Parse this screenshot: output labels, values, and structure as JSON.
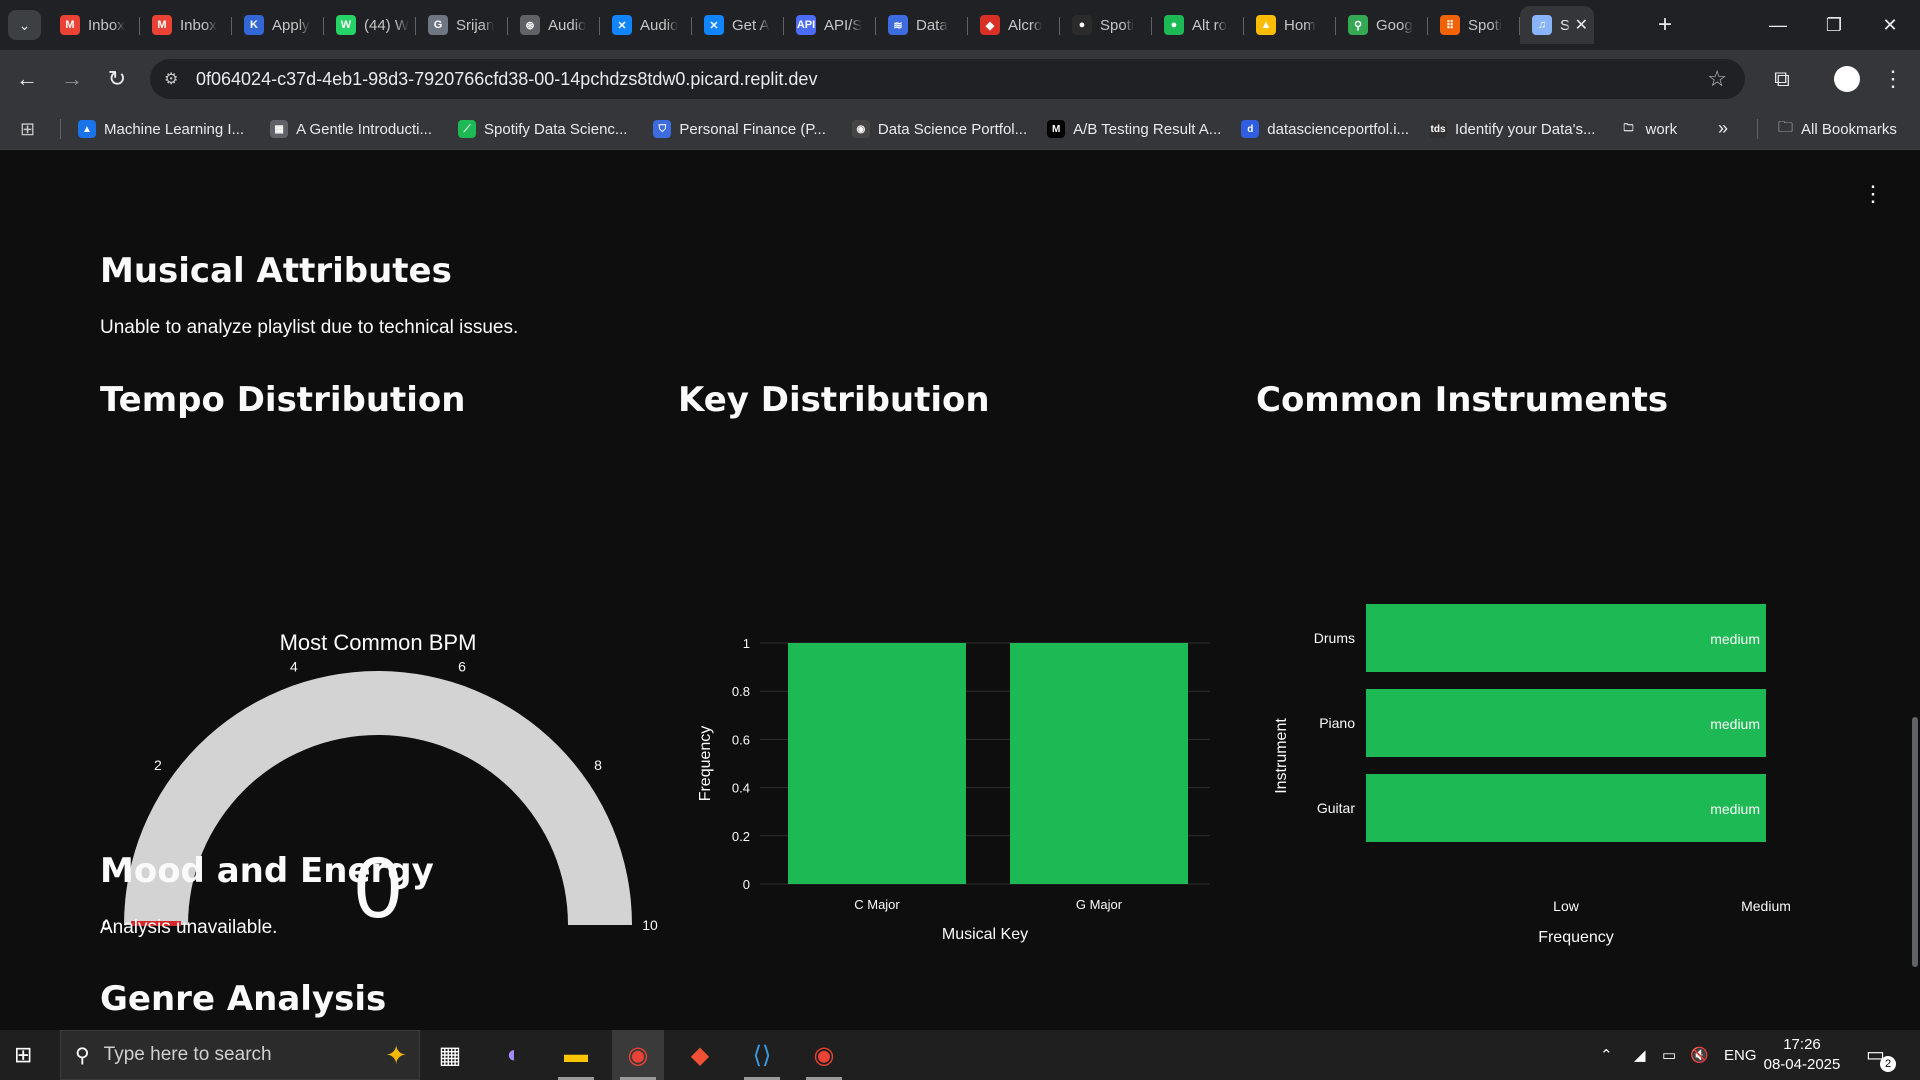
{
  "browser": {
    "tabs": [
      {
        "label": "Inbox",
        "icon": "gmail-icon",
        "color": "#ea4335",
        "glyph": "M"
      },
      {
        "label": "Inbox",
        "icon": "gmail-icon",
        "color": "#ea4335",
        "glyph": "M"
      },
      {
        "label": "Apply",
        "icon": "apply-icon",
        "color": "#3367d6",
        "glyph": "K"
      },
      {
        "label": "(44) W",
        "icon": "whatsapp-icon",
        "color": "#25d366",
        "glyph": "W"
      },
      {
        "label": "Srijan",
        "icon": "github-icon",
        "color": "#6e7681",
        "glyph": "G"
      },
      {
        "label": "Audio",
        "icon": "openai-icon",
        "color": "#5f6368",
        "glyph": "⊛"
      },
      {
        "label": "Audio",
        "icon": "bluesky-icon",
        "color": "#1185fe",
        "glyph": "✕"
      },
      {
        "label": "Get A",
        "icon": "bluesky-icon",
        "color": "#1185fe",
        "glyph": "✕"
      },
      {
        "label": "API/S",
        "icon": "api-icon",
        "color": "#4a6cf7",
        "glyph": "API"
      },
      {
        "label": "Data",
        "icon": "data-icon",
        "color": "#3c6ce0",
        "glyph": "≋"
      },
      {
        "label": "Alcro",
        "icon": "alcro-icon",
        "color": "#d93025",
        "glyph": "◆"
      },
      {
        "label": "Spoti",
        "icon": "spotify-dark-icon",
        "color": "#2b2b2b",
        "glyph": "●"
      },
      {
        "label": "Alt ro",
        "icon": "spotify-icon",
        "color": "#1db954",
        "glyph": "●"
      },
      {
        "label": "Hom",
        "icon": "drive-icon",
        "color": "#fbbc04",
        "glyph": "▲"
      },
      {
        "label": "Goog",
        "icon": "maps-icon",
        "color": "#34a853",
        "glyph": "⚲"
      },
      {
        "label": "Spoti",
        "icon": "replit-icon",
        "color": "#f26207",
        "glyph": "⠿"
      }
    ],
    "active_tab": {
      "label": "S",
      "icon": "music-icon",
      "color": "#8ab4f8",
      "glyph": "♫"
    },
    "url": "0f064024-c37d-4eb1-98d3-7920766cfd38-00-14pchdzs8tdw0.picard.replit.dev",
    "bookmarks": [
      {
        "label": "Machine Learning I...",
        "color": "#1a73e8",
        "glyph": "▲"
      },
      {
        "label": "A Gentle Introducti...",
        "color": "#5f6368",
        "glyph": "▦"
      },
      {
        "label": "Spotify Data Scienc...",
        "color": "#1db954",
        "glyph": "⟋"
      },
      {
        "label": "Personal Finance (P...",
        "color": "#3c6ce0",
        "glyph": "⛉"
      },
      {
        "label": "Data Science Portfol...",
        "color": "#444",
        "glyph": "◉"
      },
      {
        "label": "A/B Testing Result A...",
        "color": "#000",
        "glyph": "M"
      },
      {
        "label": "datascienceportfol.i...",
        "color": "#2f5fe0",
        "glyph": "d"
      },
      {
        "label": "Identify your Data's...",
        "color": "#303030",
        "glyph": "tds"
      },
      {
        "label": "work",
        "color": "transparent",
        "glyph": "🗀"
      }
    ],
    "more": "»",
    "all_bookmarks": "All Bookmarks"
  },
  "page": {
    "musical_attributes": {
      "title": "Musical Attributes",
      "message": "Unable to analyze playlist due to technical issues."
    },
    "tempo": {
      "title": "Tempo Distribution"
    },
    "key": {
      "title": "Key Distribution"
    },
    "instruments": {
      "title": "Common Instruments"
    },
    "mood": {
      "title": "Mood and Energy",
      "message": "Analysis unavailable."
    },
    "genre": {
      "title": "Genre Analysis"
    }
  },
  "chart_data": [
    {
      "type": "gauge",
      "title": "Most Common BPM",
      "value": 0,
      "range": [
        0,
        10
      ],
      "ticks": [
        "0",
        "2",
        "4",
        "6",
        "8",
        "10"
      ],
      "bar_color": "#d62728",
      "track_color": "#d3d3d3"
    },
    {
      "type": "bar",
      "categories": [
        "C Major",
        "G Major"
      ],
      "values": [
        1,
        1
      ],
      "xlabel": "Musical Key",
      "ylabel": "Frequency",
      "ylim": [
        0,
        1
      ],
      "yticks": [
        "0",
        "0.2",
        "0.4",
        "0.6",
        "0.8",
        "1"
      ],
      "color": "#1db954"
    },
    {
      "type": "bar",
      "orientation": "horizontal",
      "categories": [
        "Drums",
        "Piano",
        "Guitar"
      ],
      "values": [
        "medium",
        "medium",
        "medium"
      ],
      "xlabel": "Frequency",
      "ylabel": "Instrument",
      "xticks": [
        "Low",
        "Medium"
      ],
      "color": "#1db954"
    }
  ],
  "taskbar": {
    "search_placeholder": "Type here to search",
    "apps": [
      "task-view",
      "copilot",
      "file-explorer",
      "chrome",
      "git",
      "vscode",
      "chrome-profile"
    ],
    "lang": "ENG",
    "time": "17:26",
    "date": "08-04-2025",
    "notifications": "2"
  }
}
